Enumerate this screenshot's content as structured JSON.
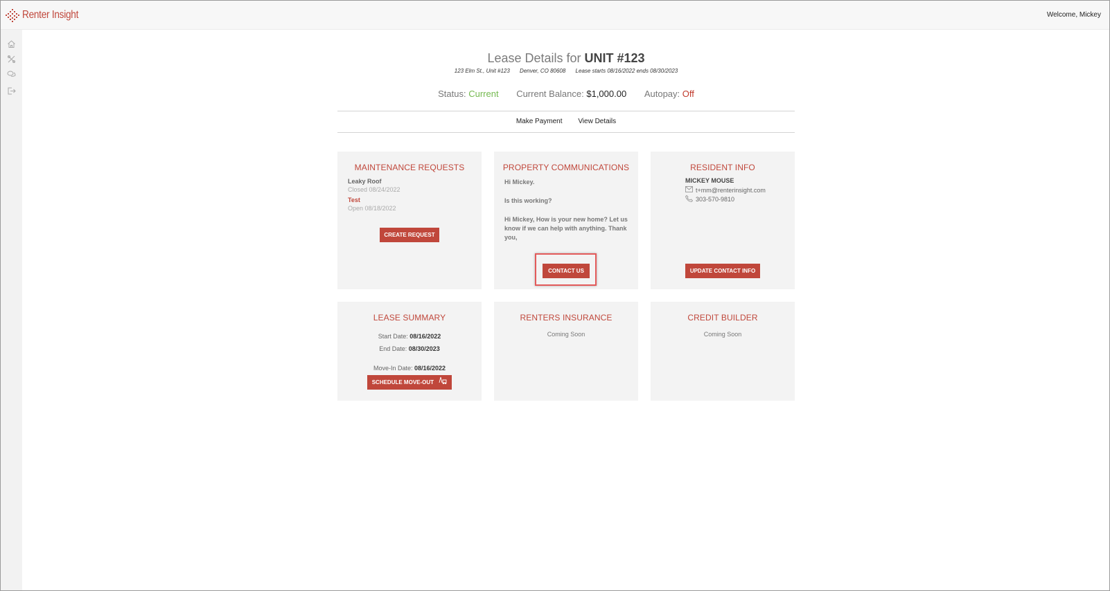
{
  "app": {
    "logo_text": "Renter Insight",
    "welcome": "Welcome, Mickey"
  },
  "header": {
    "title_prefix": "Lease Details for ",
    "title_unit": "UNIT #123",
    "address": "123 Elm St., Unit #123",
    "city": "Denver, CO 80608",
    "lease_dates": "Lease starts 08/16/2022 ends 08/30/2023",
    "status_label": "Status: ",
    "status_value": "Current",
    "balance_label": "Current Balance: ",
    "balance_value": "$1,000.00",
    "autopay_label": "Autopay: ",
    "autopay_value": "Off"
  },
  "subnav": {
    "make_payment": "Make Payment",
    "view_details": "View Details"
  },
  "maintenance": {
    "title": "MAINTENANCE REQUESTS",
    "items": [
      {
        "title": "Leaky Roof",
        "sub": "Closed 08/24/2022"
      },
      {
        "title": "Test",
        "sub": "Open 08/18/2022"
      }
    ],
    "button": "CREATE REQUEST"
  },
  "communications": {
    "title": "PROPERTY COMMUNICATIONS",
    "messages": [
      "Hi Mickey.",
      "Is this working?",
      "Hi Mickey, How is your new home? Let us know if we can help with anything. Thank you,"
    ],
    "button": "CONTACT US"
  },
  "resident": {
    "title": "RESIDENT INFO",
    "name": "MICKEY MOUSE",
    "email": "t+mm@renterinsight.com",
    "phone": "303-570-9810",
    "button": "UPDATE CONTACT INFO"
  },
  "lease_summary": {
    "title": "LEASE SUMMARY",
    "start_label": "Start Date: ",
    "start_value": "08/16/2022",
    "end_label": "End Date: ",
    "end_value": "08/30/2023",
    "movein_label": "Move-In Date: ",
    "movein_value": "08/16/2022",
    "button": "SCHEDULE MOVE-OUT"
  },
  "insurance": {
    "title": "RENTERS INSURANCE",
    "text": "Coming Soon"
  },
  "credit": {
    "title": "CREDIT BUILDER",
    "text": "Coming Soon"
  },
  "colors": {
    "accent": "#c0473b",
    "status_green": "#74b94f",
    "card_bg": "#f3f3f3"
  },
  "icons": [
    "logo-diamond-icon",
    "home-icon",
    "tools-icon",
    "chat-icon",
    "logout-icon",
    "email-icon",
    "phone-icon",
    "moving-truck-icon"
  ]
}
